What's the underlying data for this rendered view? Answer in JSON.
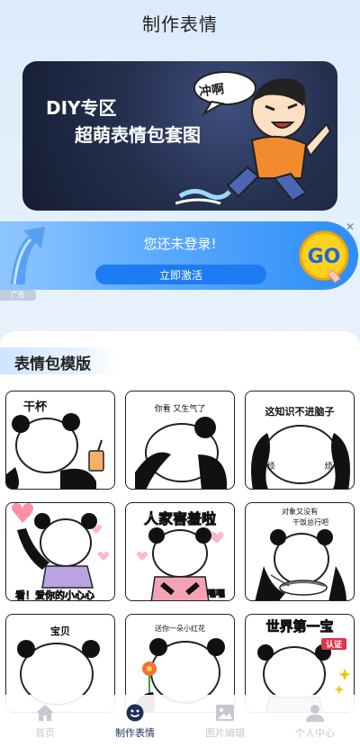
{
  "header": {
    "title": "制作表情"
  },
  "banner": {
    "line1": "DIY专区",
    "line2": "超萌表情包套图",
    "shout": "冲啊"
  },
  "promo": {
    "message": "您还未登录!",
    "button_label": "立即激活",
    "badge_text": "GO",
    "ad_tag": "广告",
    "close_icon": "close-icon"
  },
  "section": {
    "title": "表情包模版",
    "cards": [
      {
        "caption": "干杯",
        "extra": ""
      },
      {
        "caption": "你看 又生气了",
        "extra": ""
      },
      {
        "caption": "这知识不进脑子",
        "extra": "烦"
      },
      {
        "caption": "看！爱你的小心心",
        "extra": ""
      },
      {
        "caption": "人家害羞啦",
        "extra": "嘿嘿"
      },
      {
        "caption": "对象又没有",
        "extra": "干饭总行吧"
      },
      {
        "caption": "宝贝",
        "extra": ""
      },
      {
        "caption": "送你一朵小红花",
        "extra": ""
      },
      {
        "caption": "世界第一宝",
        "extra": "认证"
      }
    ]
  },
  "nav": {
    "items": [
      {
        "label": "首页",
        "icon": "home-icon"
      },
      {
        "label": "制作表情",
        "icon": "smiley-icon"
      },
      {
        "label": "图片编辑",
        "icon": "image-icon"
      },
      {
        "label": "个人中心",
        "icon": "user-icon"
      }
    ],
    "active_color": "#1f2f5c",
    "inactive_color": "#c5c9d0"
  }
}
